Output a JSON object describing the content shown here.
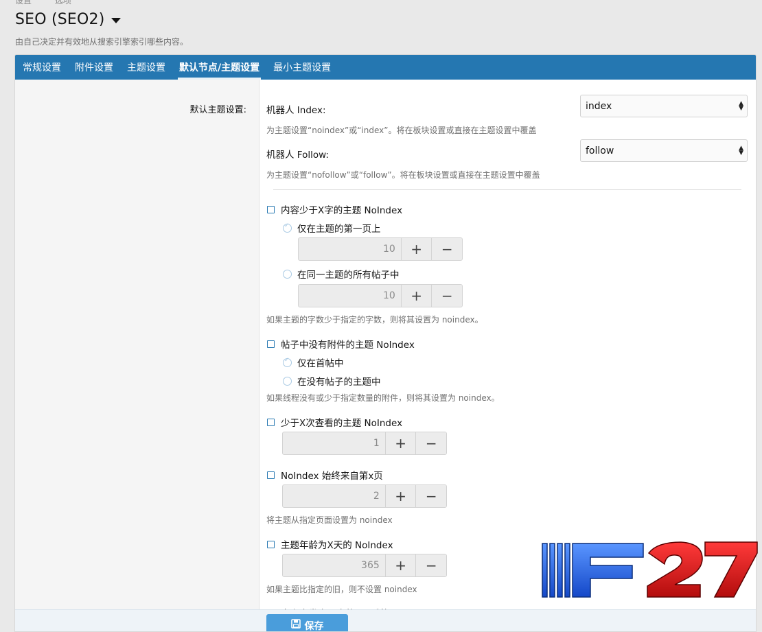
{
  "breadcrumb": [
    "设置",
    "选项"
  ],
  "page": {
    "title": "SEO (SEO2)",
    "description": "由自己决定并有效地从搜索引擎索引哪些内容。"
  },
  "tabs": [
    {
      "label": "常规设置",
      "active": false
    },
    {
      "label": "附件设置",
      "active": false
    },
    {
      "label": "主题设置",
      "active": false
    },
    {
      "label": "默认节点/主题设置",
      "active": true
    },
    {
      "label": "最小主题设置",
      "active": false
    }
  ],
  "section_label": "默认主题设置:",
  "robots_index": {
    "label": "机器人 Index:",
    "value": "index",
    "hint": "为主题设置“noindex”或“index”。将在板块设置或直接在主题设置中覆盖"
  },
  "robots_follow": {
    "label": "机器人 Follow:",
    "value": "follow",
    "hint": "为主题设置“nofollow”或“follow”。将在板块设置或直接在主题设置中覆盖"
  },
  "content_words": {
    "label": "内容少于X字的主题 NoIndex",
    "radio1_label": "仅在主题的第一页上",
    "radio1_value": "10",
    "radio2_label": "在同一主题的所有帖子中",
    "radio2_value": "10",
    "hint": "如果主题的字数少于指定的字数，则将其设置为 noindex。"
  },
  "no_attach": {
    "label": "帖子中没有附件的主题 NoIndex",
    "radio1_label": "仅在首帖中",
    "radio2_label": "在没有帖子的主题中",
    "hint": "如果线程没有或少于指定数量的附件，则将其设置为 noindex。"
  },
  "views": {
    "label": "少于X次查看的主题 NoIndex",
    "value": "1"
  },
  "page_from": {
    "label": "NoIndex 始终来自第x页",
    "value": "2",
    "hint": "将主题从指定页面设置为 noindex"
  },
  "age": {
    "label": "主题年龄为X天的 NoIndex",
    "value": "365",
    "hint": "如果主题比指定的旧，则不设置 noindex"
  },
  "last_partial": {
    "label": "自上次发表以来的X天后的 NoIndex"
  },
  "controls": {
    "plus": "+",
    "minus": "−"
  },
  "save_label": "保存",
  "watermark_text": "F27",
  "colors": {
    "accent": "#2577b1",
    "button": "#4a9ddb",
    "watermark_blue": "#1f66e0",
    "watermark_red": "#d81d1d"
  }
}
